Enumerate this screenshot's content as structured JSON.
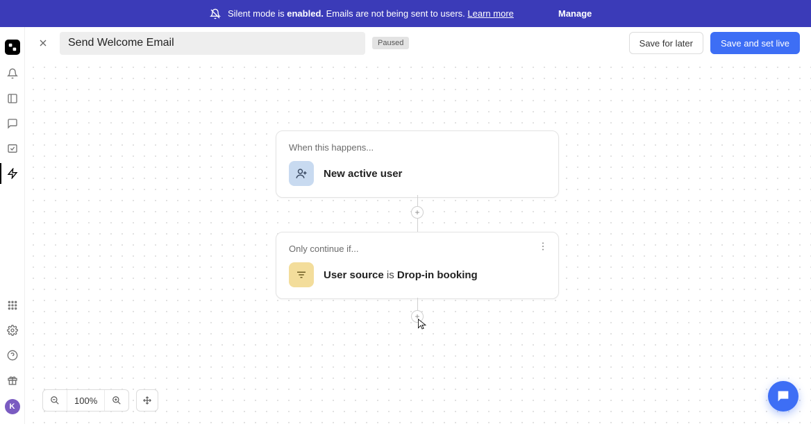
{
  "banner": {
    "prefix": "Silent mode is ",
    "bold": "enabled.",
    "suffix": " Emails are not being sent to users. ",
    "learn_more": "Learn more",
    "manage": "Manage"
  },
  "header": {
    "title": "Send Welcome Email",
    "status": "Paused",
    "save_later": "Save for later",
    "save_live": "Save and set live"
  },
  "trigger": {
    "label": "When this happens...",
    "title": "New active user"
  },
  "condition": {
    "label": "Only continue if...",
    "field": "User source",
    "operator": " is ",
    "value": "Drop-in booking"
  },
  "zoom": {
    "level": "100%"
  },
  "avatar": {
    "initial": "K"
  }
}
